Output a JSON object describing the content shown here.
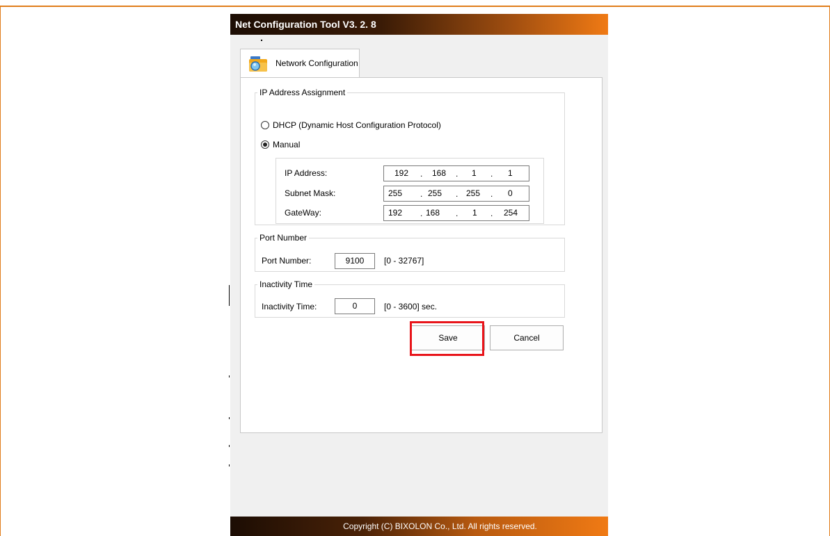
{
  "window": {
    "title": "Net Configuration Tool V3. 2. 8",
    "footer": "Copyright (C) BIXOLON Co., Ltd. All rights reserved."
  },
  "tabs": [
    {
      "label": "Network Configuration",
      "icon": "folder-search-icon",
      "active": true
    }
  ],
  "ip_assignment": {
    "legend": "IP Address Assignment",
    "dhcp_label": "DHCP (Dynamic Host Configuration Protocol)",
    "manual_label": "Manual",
    "selected": "Manual",
    "rows": [
      {
        "label": "IP Address:",
        "octets": [
          "192",
          "168",
          "1",
          "1"
        ]
      },
      {
        "label": "Subnet Mask:",
        "octets": [
          "255",
          "255",
          "255",
          "0"
        ]
      },
      {
        "label": "GateWay:",
        "octets": [
          "192",
          "168",
          "1",
          "254"
        ]
      }
    ],
    "separator": "."
  },
  "port": {
    "legend": "Port Number",
    "label": "Port Number:",
    "value": "9100",
    "range": "[0 - 32767]"
  },
  "inactivity": {
    "legend": "Inactivity Time",
    "label": "Inactivity Time:",
    "value": "0",
    "range": "[0 - 3600] sec."
  },
  "buttons": {
    "save": "Save",
    "cancel": "Cancel"
  },
  "colors": {
    "accent": "#f07a14",
    "highlight": "#e8141a"
  }
}
